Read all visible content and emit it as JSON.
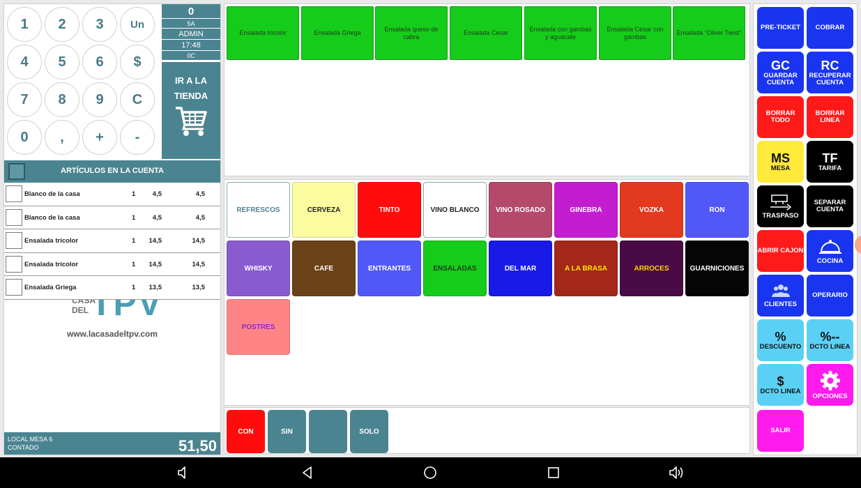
{
  "keypad": {
    "keys": [
      "1",
      "2",
      "3",
      "Un",
      "4",
      "5",
      "6",
      "$",
      "7",
      "8",
      "9",
      "C",
      "0",
      ",",
      "+",
      "-"
    ]
  },
  "info": {
    "count": "0",
    "table_code": "5A",
    "user": "ADMIN",
    "time": "17:48",
    "extra": "0C",
    "shop_label": "IR A LA TIENDA"
  },
  "account": {
    "title": "ARTÍCULOS EN LA CUENTA",
    "items": [
      {
        "name": "Blanco de la casa",
        "qty": "1",
        "price": "4,5",
        "total": "4,5"
      },
      {
        "name": "Blanco de la casa",
        "qty": "1",
        "price": "4,5",
        "total": "4,5"
      },
      {
        "name": "Ensalada tricolor",
        "qty": "1",
        "price": "14,5",
        "total": "14,5"
      },
      {
        "name": "Ensalada tricolor",
        "qty": "1",
        "price": "14,5",
        "total": "14,5"
      },
      {
        "name": "Ensalada Griega",
        "qty": "1",
        "price": "13,5",
        "total": "13,5"
      }
    ],
    "logo_top": "CASA",
    "logo_mid": "DEL",
    "logo_big": "TPV",
    "logo_url": "www.lacasadeltpv.com",
    "location": "LOCAL MESA 6",
    "payment": "CONTADO",
    "total": "51,50"
  },
  "products": [
    "Ensalada tricolor",
    "Ensalada Griega",
    "Ensalada queso de cabra",
    "Ensalada Cesar",
    "Ensalada con gambas y aguacate",
    "Ensalada Cesar con gambas",
    "Ensalada \"Oliver Twist\""
  ],
  "families": [
    {
      "label": "REFRESCOS",
      "bg": "#ffffff",
      "fg": "#4b8491"
    },
    {
      "label": "CERVEZA",
      "bg": "#fbfba0",
      "fg": "#222222"
    },
    {
      "label": "TINTO",
      "bg": "#ff0d0d",
      "fg": "#ffffff"
    },
    {
      "label": "VINO BLANCO",
      "bg": "#ffffff",
      "fg": "#222222"
    },
    {
      "label": "VINO ROSADO",
      "bg": "#b34a6b",
      "fg": "#ffffff"
    },
    {
      "label": "GINEBRA",
      "bg": "#c41dcf",
      "fg": "#ffffff"
    },
    {
      "label": "VOZKA",
      "bg": "#e3391f",
      "fg": "#ffffff"
    },
    {
      "label": "RON",
      "bg": "#5258f7",
      "fg": "#ffffff"
    },
    {
      "label": "WHISKY",
      "bg": "#8a5bcf",
      "fg": "#ffffff"
    },
    {
      "label": "CAFE",
      "bg": "#6b4218",
      "fg": "#ffffff"
    },
    {
      "label": "ENTRANTES",
      "bg": "#5258f7",
      "fg": "#ffffff"
    },
    {
      "label": "ENSALADAS",
      "bg": "#16cc1a",
      "fg": "#1f3d1f"
    },
    {
      "label": "DEL MAR",
      "bg": "#1919e8",
      "fg": "#ffffff"
    },
    {
      "label": "A LA BRASA",
      "bg": "#a32819",
      "fg": "#ffe600"
    },
    {
      "label": "ARROCES",
      "bg": "#4a0a45",
      "fg": "#ffd200"
    },
    {
      "label": "GUARNICIONES",
      "bg": "#050505",
      "fg": "#ffffff"
    },
    {
      "label": "POSTRES",
      "bg": "#ff8585",
      "fg": "#8a2bd0"
    }
  ],
  "modifiers": [
    {
      "label": "CON",
      "bg": "#ff0d0d"
    },
    {
      "label": "SIN",
      "bg": "#4b8491"
    },
    {
      "label": "",
      "bg": "#4b8491"
    },
    {
      "label": "SOLO",
      "bg": "#4b8491"
    }
  ],
  "actions": [
    {
      "big": "",
      "label": "PRE-TICKET",
      "bg": "#1a35f0",
      "icon": ""
    },
    {
      "big": "",
      "label": "COBRAR",
      "bg": "#1a35f0",
      "icon": ""
    },
    {
      "big": "GC",
      "label": "GUARDAR CUENTA",
      "bg": "#1a35f0",
      "icon": ""
    },
    {
      "big": "RC",
      "label": "RECUPERAR CUENTA",
      "bg": "#1a35f0",
      "icon": ""
    },
    {
      "big": "",
      "label": "BORRAR TODO",
      "bg": "#ff1a1a",
      "icon": ""
    },
    {
      "big": "",
      "label": "BORRAR LINEA",
      "bg": "#ff1a1a",
      "icon": ""
    },
    {
      "big": "MS",
      "label": "MESA",
      "bg": "#ffe93b",
      "icon": "",
      "fg": "#111111"
    },
    {
      "big": "TF",
      "label": "TARIFA",
      "bg": "#000000",
      "icon": ""
    },
    {
      "big": "",
      "label": "TRASPASO",
      "bg": "#000000",
      "icon": "transfer-icon"
    },
    {
      "big": "",
      "label": "SEPARAR CUENTA",
      "bg": "#000000",
      "icon": ""
    },
    {
      "big": "",
      "label": "ABRIR CAJON",
      "bg": "#ff1a1a",
      "icon": ""
    },
    {
      "big": "",
      "label": "COCINA",
      "bg": "#1a35f0",
      "icon": "bell-icon"
    },
    {
      "big": "",
      "label": "CLIENTES",
      "bg": "#1a35f0",
      "icon": "users-icon"
    },
    {
      "big": "",
      "label": "OPERARIO",
      "bg": "#1a35f0",
      "icon": ""
    },
    {
      "big": "%",
      "label": "DESCUENTO",
      "bg": "#5bd0f5",
      "icon": "",
      "fg": "#111111"
    },
    {
      "big": "%--",
      "label": "DCTO LINEA",
      "bg": "#5bd0f5",
      "icon": "",
      "fg": "#111111"
    },
    {
      "big": "$",
      "label": "DCTO LINEA",
      "bg": "#5bd0f5",
      "icon": "",
      "fg": "#111111"
    },
    {
      "big": "",
      "label": "OPCIONES",
      "bg": "#ff1aee",
      "icon": "gear-icon"
    },
    {
      "big": "",
      "label": "SALIR",
      "bg": "#ff1aee",
      "icon": ""
    }
  ]
}
